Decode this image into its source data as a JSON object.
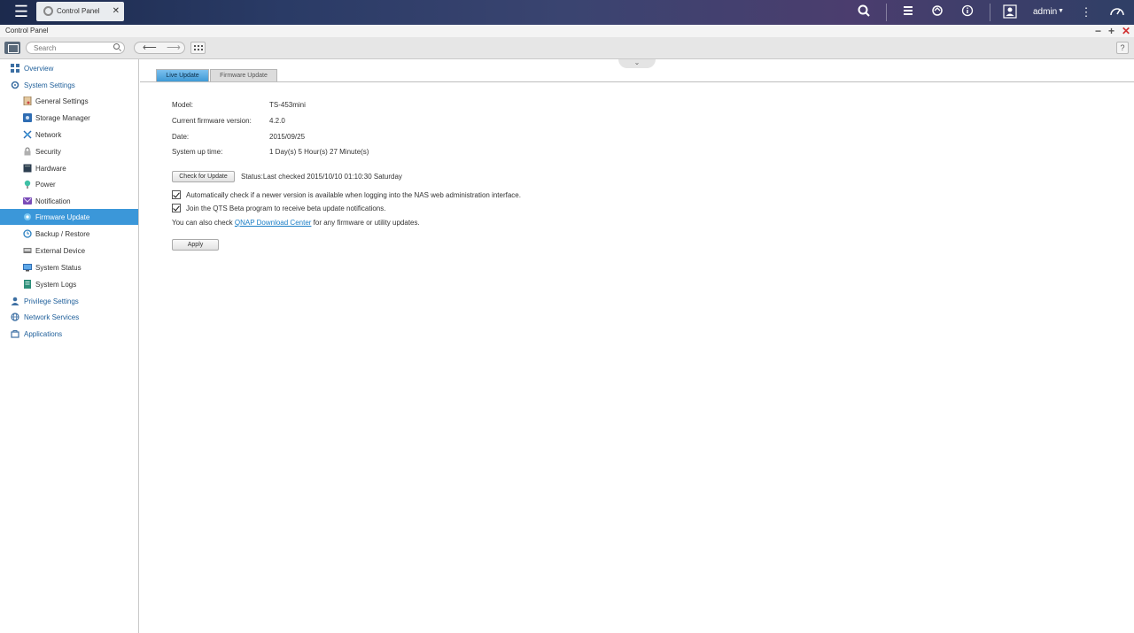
{
  "topbar": {
    "app_tab_label": "Control Panel",
    "user": "admin",
    "icons": [
      "menu-icon",
      "search-icon",
      "stack-icon",
      "sync-icon",
      "info-icon",
      "user-icon",
      "more-icon",
      "dashboard-icon"
    ]
  },
  "window": {
    "title": "Control Panel"
  },
  "toolbar": {
    "search_placeholder": "Search",
    "help": "?"
  },
  "sidebar": {
    "items": [
      {
        "label": "Overview",
        "level": "top"
      },
      {
        "label": "System Settings",
        "level": "top"
      },
      {
        "label": "General Settings",
        "level": "sub"
      },
      {
        "label": "Storage Manager",
        "level": "sub"
      },
      {
        "label": "Network",
        "level": "sub"
      },
      {
        "label": "Security",
        "level": "sub"
      },
      {
        "label": "Hardware",
        "level": "sub"
      },
      {
        "label": "Power",
        "level": "sub"
      },
      {
        "label": "Notification",
        "level": "sub"
      },
      {
        "label": "Firmware Update",
        "level": "sub",
        "active": true
      },
      {
        "label": "Backup / Restore",
        "level": "sub"
      },
      {
        "label": "External Device",
        "level": "sub"
      },
      {
        "label": "System Status",
        "level": "sub"
      },
      {
        "label": "System Logs",
        "level": "sub"
      },
      {
        "label": "Privilege Settings",
        "level": "top"
      },
      {
        "label": "Network Services",
        "level": "top"
      },
      {
        "label": "Applications",
        "level": "top"
      }
    ]
  },
  "tabs": {
    "live": "Live Update",
    "firmware": "Firmware Update"
  },
  "info": {
    "model_label": "Model:",
    "model_value": "TS-453mini",
    "fw_label": "Current firmware version:",
    "fw_value": "4.2.0",
    "date_label": "Date:",
    "date_value": "2015/09/25",
    "uptime_label": "System up time:",
    "uptime_value": "1 Day(s) 5 Hour(s) 27 Minute(s)"
  },
  "update": {
    "check_button": "Check for Update",
    "status": "Status:Last checked 2015/10/10 01:10:30 Saturday",
    "auto_check_label": "Automatically check if a newer version is available when logging into the NAS web administration interface.",
    "beta_label": "Join the QTS Beta program to receive beta update notifications.",
    "also_prefix": "You can also check ",
    "link_text": "QNAP Download Center",
    "also_suffix": " for any firmware or utility updates.",
    "apply_button": "Apply"
  },
  "colors": {
    "accent": "#3b97d9",
    "link": "#1a7ec6",
    "nav_text": "#1f5f9a"
  }
}
